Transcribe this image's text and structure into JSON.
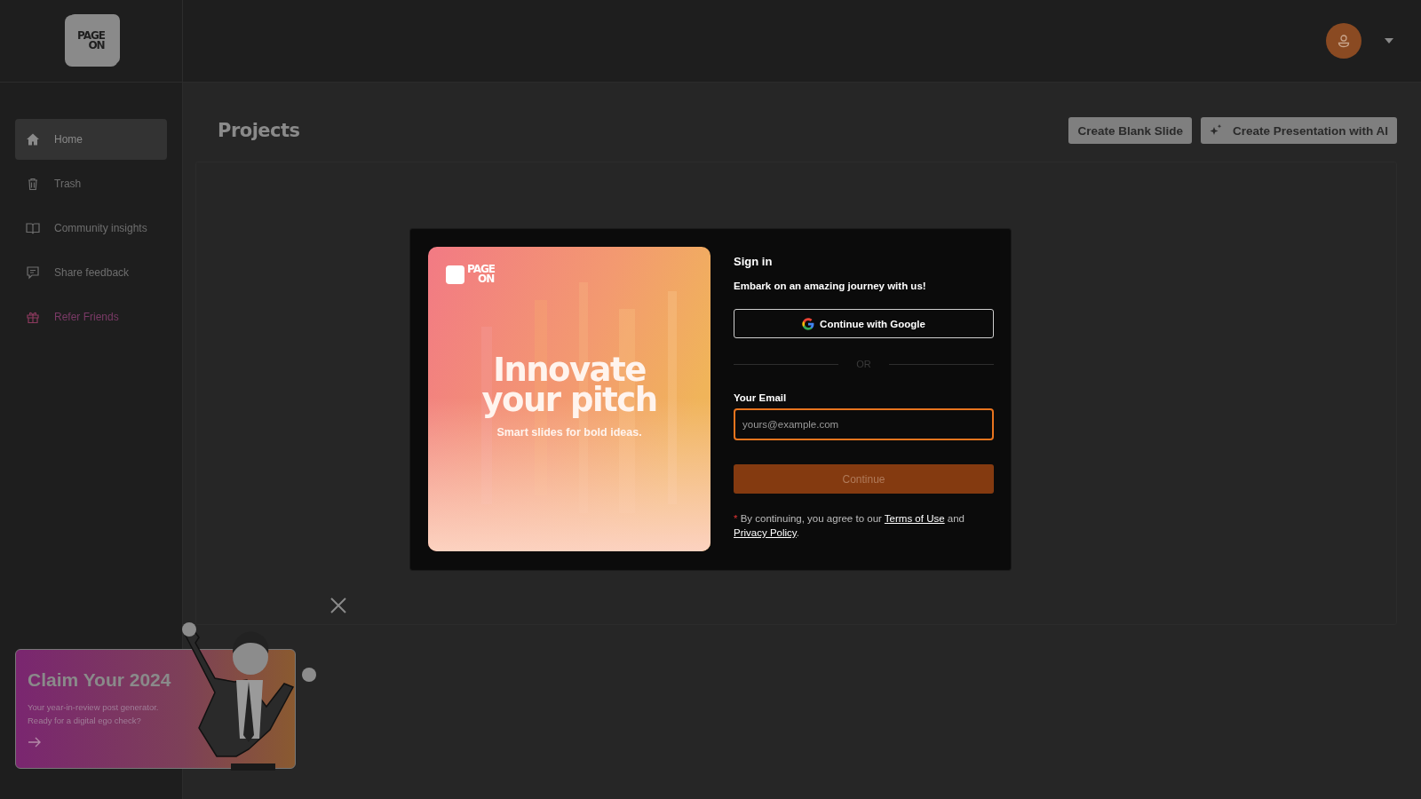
{
  "app_logo": {
    "lines": [
      "PAGE",
      "ON"
    ]
  },
  "sidebar": {
    "items": [
      {
        "label": "Home",
        "kind": "home",
        "selected": true,
        "highlighted": false
      },
      {
        "label": "Trash",
        "kind": "trash",
        "selected": false,
        "highlighted": false
      },
      {
        "label": "Community insights",
        "kind": "book",
        "selected": false,
        "highlighted": false
      },
      {
        "label": "Share feedback",
        "kind": "feedback",
        "selected": false,
        "highlighted": false
      },
      {
        "label": "Refer Friends",
        "kind": "gift",
        "selected": false,
        "highlighted": true
      }
    ]
  },
  "page_title": "Projects",
  "actions": [
    {
      "label": "Create Blank Slide",
      "kind": "plain"
    },
    {
      "label": "Create Presentation with AI",
      "kind": "ai"
    }
  ],
  "promo": {
    "title": "Claim Your 2024",
    "lines": [
      "Your year-in-review post generator.",
      "Ready for a digital ego check?"
    ]
  },
  "signin": {
    "hero": {
      "logo_lines": [
        "PAGE",
        "ON"
      ],
      "headline_lines": [
        "Innovate",
        "your pitch"
      ],
      "tagline": "Smart slides for bold ideas."
    },
    "title": "Sign in",
    "subtitle": "Embark on an amazing journey with us!",
    "google_button": "Continue with Google",
    "divider": "OR",
    "email_label": "Your Email",
    "email_placeholder": "yours@example.com",
    "email_focused": true,
    "continue_button": "Continue",
    "continue_disabled": true,
    "legal": {
      "mark": "*",
      "before": " By continuing, you agree to our ",
      "link_1": "Terms of Use",
      "middle": " and ",
      "link_2": "Privacy Policy",
      "after": "."
    }
  }
}
